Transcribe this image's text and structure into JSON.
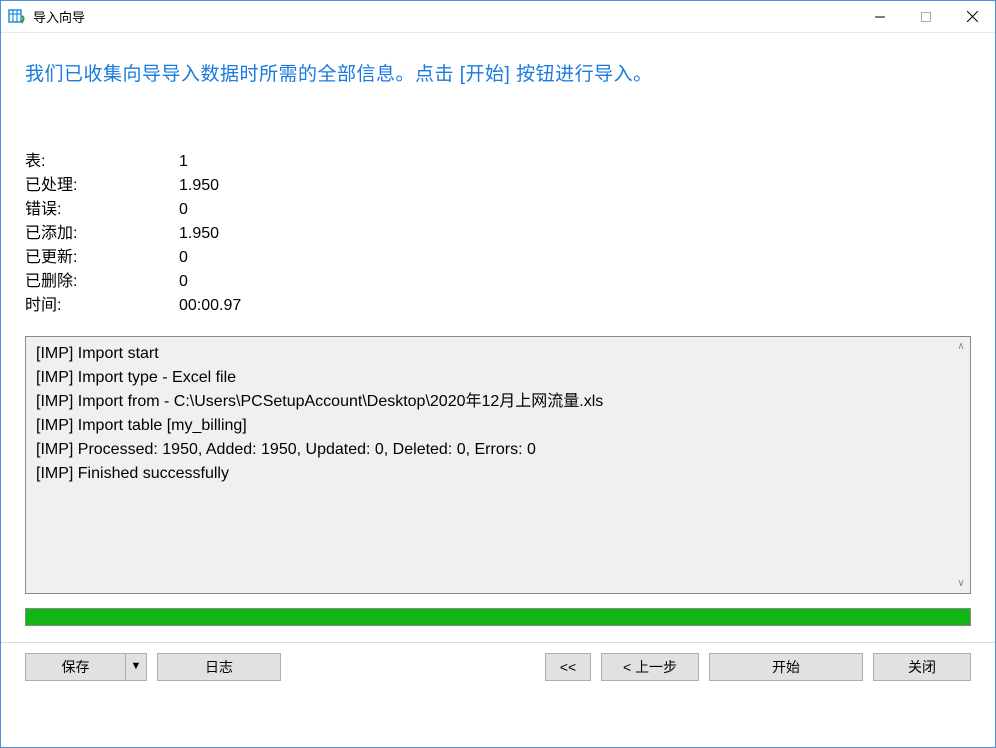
{
  "titlebar": {
    "title": "导入向导"
  },
  "heading": "我们已收集向导导入数据时所需的全部信息。点击 [开始] 按钮进行导入。",
  "stats": {
    "rows": [
      {
        "label": "表:",
        "value": "1"
      },
      {
        "label": "已处理:",
        "value": "1.950"
      },
      {
        "label": "错误:",
        "value": "0"
      },
      {
        "label": "已添加:",
        "value": "1.950"
      },
      {
        "label": "已更新:",
        "value": "0"
      },
      {
        "label": "已删除:",
        "value": "0"
      },
      {
        "label": "时间:",
        "value": "00:00.97"
      }
    ]
  },
  "log": {
    "lines": [
      "[IMP] Import start",
      "[IMP] Import type - Excel file",
      "[IMP] Import from - C:\\Users\\PCSetupAccount\\Desktop\\2020年12月上网流量.xls",
      "[IMP] Import table [my_billing]",
      "[IMP] Processed: 1950, Added: 1950, Updated: 0, Deleted: 0, Errors: 0",
      "[IMP] Finished successfully"
    ]
  },
  "buttons": {
    "save": "保存",
    "log": "日志",
    "backback": "<<",
    "prev": "< 上一步",
    "start": "开始",
    "close": "关闭"
  }
}
